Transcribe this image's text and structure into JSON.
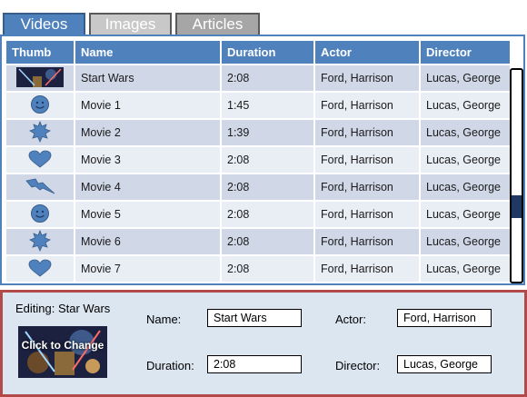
{
  "tabs": [
    {
      "label": "Videos",
      "active": true
    },
    {
      "label": "Images",
      "active": false
    },
    {
      "label": "Articles",
      "active": false
    }
  ],
  "table": {
    "columns": [
      "Thumb",
      "Name",
      "Duration",
      "Actor",
      "Director"
    ],
    "rows": [
      {
        "thumb": "star-wars-poster-icon",
        "name": "Start Wars",
        "duration": "2:08",
        "actor": "Ford, Harrison",
        "director": "Lucas, George"
      },
      {
        "thumb": "smiley-icon",
        "name": "Movie 1",
        "duration": "1:45",
        "actor": "Ford, Harrison",
        "director": "Lucas, George"
      },
      {
        "thumb": "starburst-icon",
        "name": "Movie 2",
        "duration": "1:39",
        "actor": "Ford, Harrison",
        "director": "Lucas, George"
      },
      {
        "thumb": "heart-icon",
        "name": "Movie 3",
        "duration": "2:08",
        "actor": "Ford, Harrison",
        "director": "Lucas, George"
      },
      {
        "thumb": "lightning-icon",
        "name": "Movie 4",
        "duration": "2:08",
        "actor": "Ford, Harrison",
        "director": "Lucas, George"
      },
      {
        "thumb": "smiley-icon",
        "name": "Movie 5",
        "duration": "2:08",
        "actor": "Ford, Harrison",
        "director": "Lucas, George"
      },
      {
        "thumb": "starburst-icon",
        "name": "Movie 6",
        "duration": "2:08",
        "actor": "Ford, Harrison",
        "director": "Lucas, George"
      },
      {
        "thumb": "heart-icon",
        "name": "Movie 7",
        "duration": "2:08",
        "actor": "Ford, Harrison",
        "director": "Lucas, George"
      }
    ]
  },
  "editor": {
    "title": "Editing:  Star Wars",
    "preview_label": "Click to Change",
    "name_label": "Name:",
    "name_value": "Start Wars",
    "duration_label": "Duration:",
    "duration_value": "2:08",
    "actor_label": "Actor:",
    "actor_value": "Ford, Harrison",
    "director_label": "Director:",
    "director_value": "Lucas, George"
  },
  "colors": {
    "accent": "#4f81bd",
    "row_odd": "#d0d8e8",
    "row_even": "#e9edf4",
    "edit_border": "#b34a4a",
    "edit_bg": "#dce6f1"
  }
}
